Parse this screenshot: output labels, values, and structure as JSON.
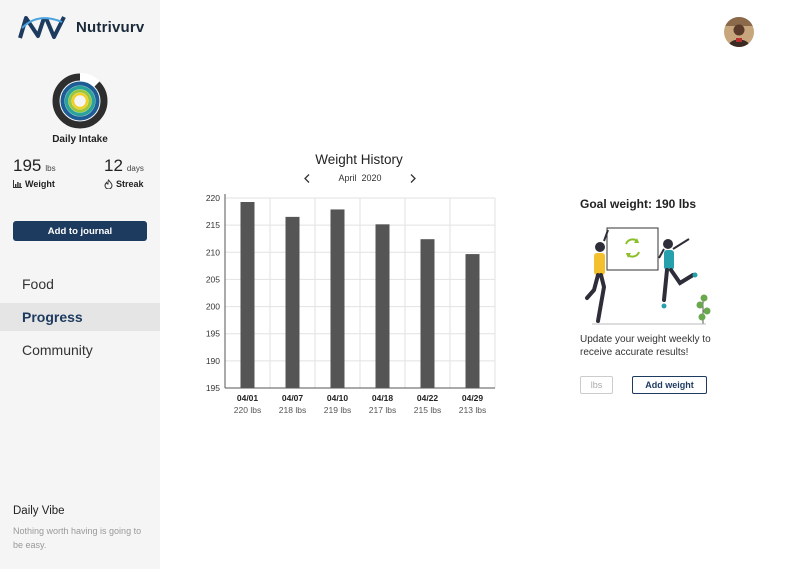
{
  "app": {
    "brand": "Nutrivurv"
  },
  "sidebar": {
    "intake_label": "Daily Intake",
    "stats": {
      "weight": {
        "value": "195",
        "unit": "lbs",
        "label": "Weight"
      },
      "streak": {
        "value": "12",
        "unit": "days",
        "label": "Streak"
      }
    },
    "add_journal_label": "Add to journal",
    "nav": [
      {
        "label": "Food",
        "active": false
      },
      {
        "label": "Progress",
        "active": true
      },
      {
        "label": "Community",
        "active": false
      }
    ],
    "daily_vibe": {
      "title": "Daily Vibe",
      "text": "Nothing worth having is going to be easy."
    }
  },
  "weight_history": {
    "title": "Weight History",
    "month": "April",
    "year": "2020"
  },
  "chart_data": {
    "type": "bar",
    "categories": [
      "04/01",
      "04/07",
      "04/10",
      "04/18",
      "04/22",
      "04/29"
    ],
    "value_labels": [
      "220 lbs",
      "218 lbs",
      "219 lbs",
      "217 lbs",
      "215 lbs",
      "213 lbs"
    ],
    "values": [
      220,
      218,
      219,
      217,
      215,
      213
    ],
    "y_ticks": [
      220,
      215,
      210,
      205,
      200,
      195,
      190,
      195
    ],
    "ylim": [
      195,
      220
    ],
    "grid": true,
    "bar_color": "#555555"
  },
  "goal": {
    "title": "Goal weight: 190 lbs",
    "update_text": "Update your weight weekly to receive accurate results!",
    "input_placeholder": "lbs",
    "add_weight_label": "Add weight"
  },
  "colors": {
    "primary": "#1d3a5f",
    "sidebar_bg": "#f5f5f5",
    "active_nav_bg": "#e5e5e5",
    "ring_dark": "#2e2e2e",
    "ring_blue": "#1e5c96",
    "ring_teal": "#2aa39b",
    "ring_green": "#9cc63a",
    "ring_yellow": "#f2cf26",
    "sync_icon": "#8cbf2b",
    "illus_yellow": "#f4c02e",
    "illus_teal": "#27a0ad",
    "plant_green": "#6aa84f"
  }
}
